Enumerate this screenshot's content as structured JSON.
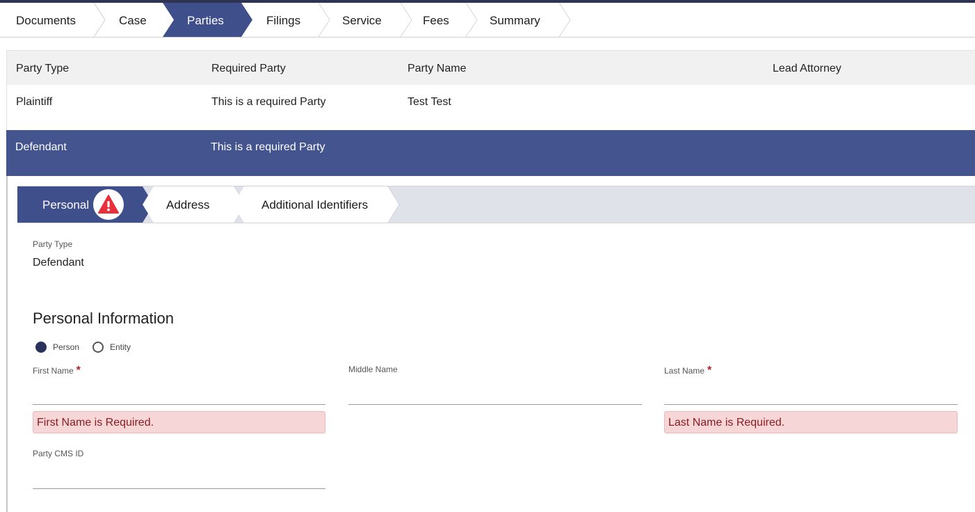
{
  "steps": [
    "Documents",
    "Case",
    "Parties",
    "Filings",
    "Service",
    "Fees",
    "Summary"
  ],
  "table": {
    "headers": [
      "Party Type",
      "Required Party",
      "Party Name",
      "Lead Attorney"
    ],
    "rows": [
      [
        "Plaintiff",
        "This is a required Party",
        "Test Test",
        ""
      ],
      [
        "Defendant",
        "This is a required Party",
        "",
        ""
      ]
    ]
  },
  "detail": {
    "tabs": [
      "Personal",
      "Address",
      "Additional Identifiers"
    ],
    "party_type_label": "Party Type",
    "party_type_value": "Defendant",
    "section_title": "Personal Information",
    "radio_person": "Person",
    "radio_entity": "Entity",
    "first_name_label": "First Name",
    "middle_name_label": "Middle Name",
    "last_name_label": "Last Name",
    "first_name_error": "First Name is Required.",
    "last_name_error": "Last Name is Required.",
    "cms_id_label": "Party CMS ID",
    "required_mark": "*"
  },
  "colors": {
    "active_step": "#3f4f8c",
    "selected_row": "#43548f",
    "error_bg": "#f7d6d8",
    "error_text": "#8a1c22",
    "warning_icon": "#e8303d"
  }
}
